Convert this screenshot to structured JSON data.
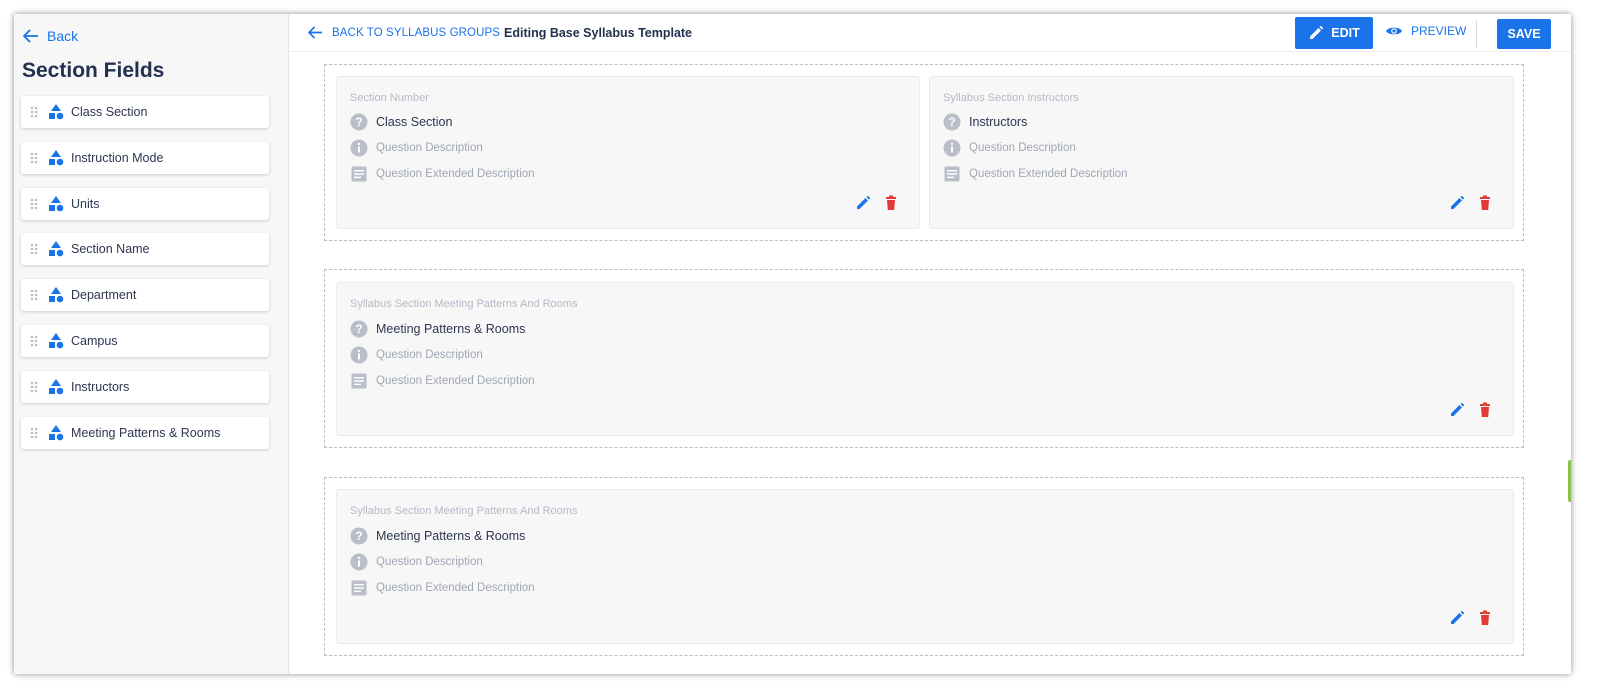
{
  "sidebar": {
    "back_label": "Back",
    "title": "Section Fields",
    "items": [
      {
        "label": "Class Section"
      },
      {
        "label": "Instruction Mode"
      },
      {
        "label": "Units"
      },
      {
        "label": "Section Name"
      },
      {
        "label": "Department"
      },
      {
        "label": "Campus"
      },
      {
        "label": "Instructors"
      },
      {
        "label": "Meeting Patterns & Rooms"
      }
    ]
  },
  "topbar": {
    "back_label": "BACK TO SYLLABUS GROUPS",
    "editing_title": "Editing Base Syllabus Template",
    "edit_label": "EDIT",
    "preview_label": "PREVIEW",
    "save_label": "SAVE"
  },
  "cards": [
    {
      "label": "Section Number",
      "name": "Class Section",
      "description": "Question Description",
      "extended": "Question Extended Description"
    },
    {
      "label": "Syllabus Section Instructors",
      "name": "Instructors",
      "description": "Question Description",
      "extended": "Question Extended Description"
    },
    {
      "label": "Syllabus Section Meeting Patterns And Rooms",
      "name": "Meeting Patterns & Rooms",
      "description": "Question Description",
      "extended": "Question Extended Description"
    },
    {
      "label": "Syllabus Section Meeting Patterns And Rooms",
      "name": "Meeting Patterns & Rooms",
      "description": "Question Description",
      "extended": "Question Extended Description"
    }
  ],
  "colors": {
    "accent": "#1a73e8",
    "delete": "#e53935",
    "muted_icon": "#b9bec9"
  },
  "icons": [
    "arrow-left-icon",
    "drag-handle-icon",
    "shapes-icon",
    "pencil-icon",
    "eye-icon",
    "question-icon",
    "info-icon",
    "description-icon",
    "trash-icon"
  ]
}
